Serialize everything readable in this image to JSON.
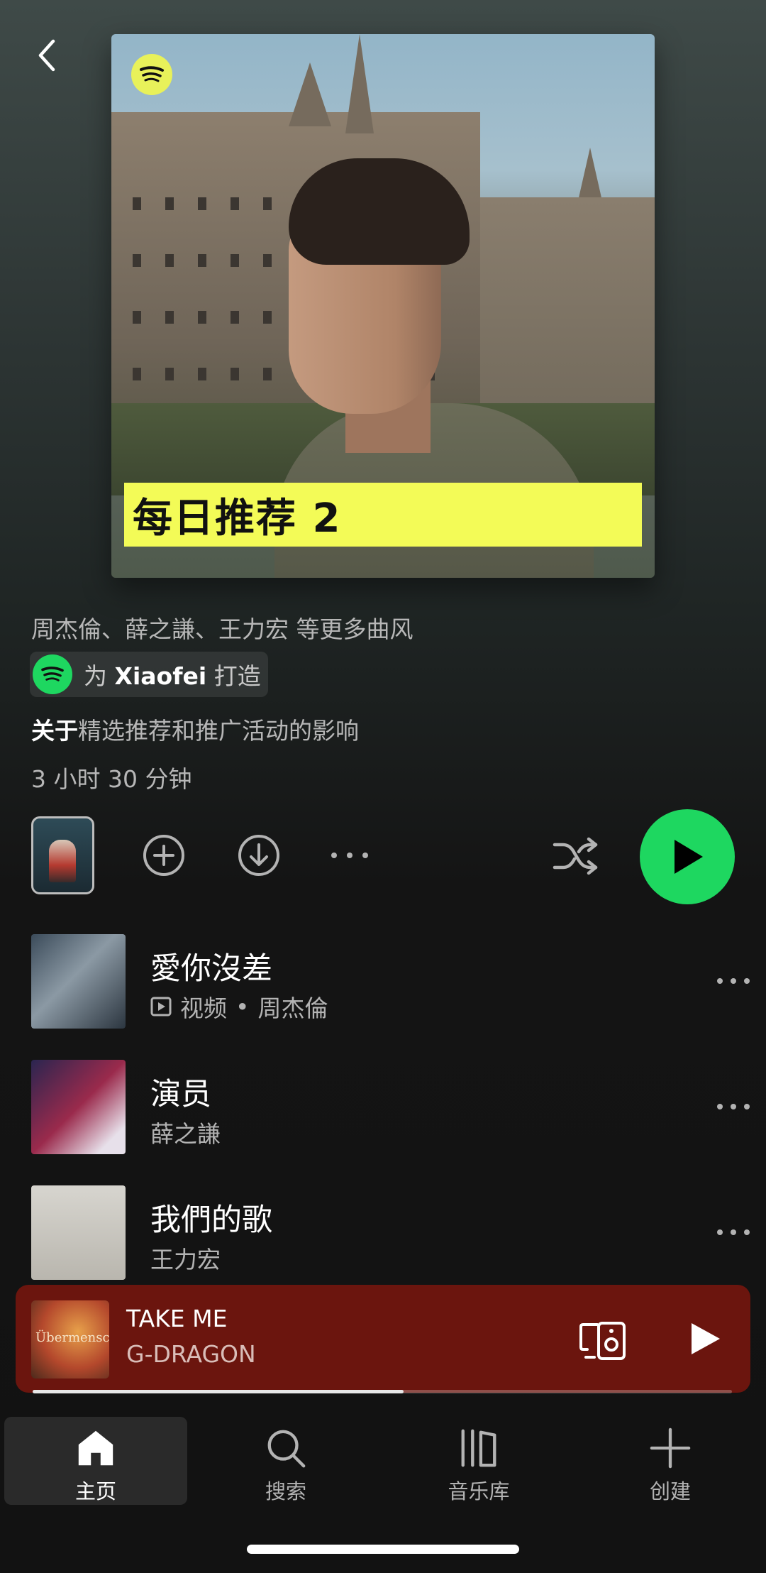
{
  "header": {
    "back_icon": "chevron-left-icon"
  },
  "cover": {
    "banner_text": "每日推荐 2",
    "logo_icon": "spotify-logo-icon"
  },
  "playlist": {
    "artists_line": "周杰倫、薛之謙、王力宏 等更多曲风",
    "made_for_prefix": "为",
    "made_for_user": "Xiaofei",
    "made_for_suffix": "打造",
    "about_strong": "关于",
    "about_rest": "精选推荐和推广活动的影响",
    "duration": "3 小时 30 分钟"
  },
  "actions": {
    "add_icon": "plus-circle-icon",
    "download_icon": "download-icon",
    "more_icon": "more-icon",
    "shuffle_icon": "shuffle-icon",
    "play_icon": "play-icon",
    "accent": "#1ed760"
  },
  "tracks": [
    {
      "title": "愛你沒差",
      "video_label": "视频",
      "separator": "•",
      "artist": "周杰倫",
      "has_video": true
    },
    {
      "title": "演员",
      "artist": "薛之謙",
      "has_video": false
    },
    {
      "title": "我們的歌",
      "artist": "王力宏",
      "has_video": false
    }
  ],
  "mini_player": {
    "title": "TAKE ME",
    "artist": "G-DRAGON",
    "art_text": "Übermensch",
    "progress": 0.53,
    "background": "#6b150e",
    "devices_icon": "connect-devices-icon",
    "play_icon": "play-icon"
  },
  "nav": {
    "items": [
      {
        "label": "主页",
        "icon": "home-icon",
        "active": true
      },
      {
        "label": "搜索",
        "icon": "search-icon",
        "active": false
      },
      {
        "label": "音乐库",
        "icon": "library-icon",
        "active": false
      },
      {
        "label": "创建",
        "icon": "plus-icon",
        "active": false
      }
    ]
  }
}
